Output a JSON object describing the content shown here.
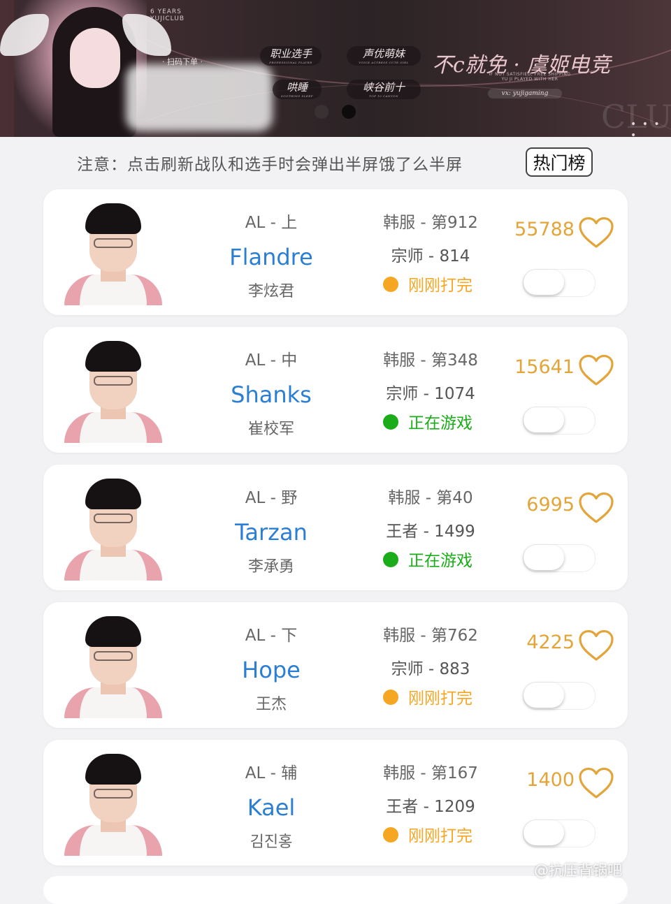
{
  "banner": {
    "years": "6 YEARS",
    "club": "YUJICLUB",
    "scan_text": "· 扫码下单 ·",
    "tags": [
      {
        "label": "职业选手",
        "sub": "PROFESSIONAL PLAYER"
      },
      {
        "label": "声优萌妹",
        "sub": "VOICE ACTRESS CUTE GIRL"
      },
      {
        "label": "峡谷前十",
        "sub": "TOP 10 CANYON"
      },
      {
        "label": "哄睡",
        "sub": "SOOTHING SLEEP"
      }
    ],
    "slogan": "不c就免 · 虞姬电竞",
    "slogan_sub_1": "IF NOT SATISFIED, FREE SHIPPING",
    "slogan_sub_2": "YU JI PLAYED WITH HER",
    "vx": "vx: yujigaming",
    "more": "• • • •",
    "watermark_letters": "CLUB"
  },
  "notice": "注意：点击刷新战队和选手时会弹出半屏饿了么半屏",
  "hot_button": "热门榜",
  "colors": {
    "name_blue": "#2a7fd4",
    "likes_orange": "#e3a53a",
    "status_orange": "#f5a623",
    "status_green": "#1aad19"
  },
  "players": [
    {
      "position": "AL - 上",
      "name": "Flandre",
      "real_name": "李炫君",
      "server": "韩服 - 第912",
      "rank": "宗师 - 814",
      "status": "刚刚打完",
      "status_type": "finished",
      "likes": "55788"
    },
    {
      "position": "AL - 中",
      "name": "Shanks",
      "real_name": "崔校军",
      "server": "韩服 - 第348",
      "rank": "宗师 - 1074",
      "status": "正在游戏",
      "status_type": "playing",
      "likes": "15641"
    },
    {
      "position": "AL - 野",
      "name": "Tarzan",
      "real_name": "李承勇",
      "server": "韩服 - 第40",
      "rank": "王者 - 1499",
      "status": "正在游戏",
      "status_type": "playing",
      "likes": "6995"
    },
    {
      "position": "AL - 下",
      "name": "Hope",
      "real_name": "王杰",
      "server": "韩服 - 第762",
      "rank": "宗师 - 883",
      "status": "刚刚打完",
      "status_type": "finished",
      "likes": "4225"
    },
    {
      "position": "AL - 辅",
      "name": "Kael",
      "real_name": "김진홍",
      "server": "韩服 - 第167",
      "rank": "王者 - 1209",
      "status": "刚刚打完",
      "status_type": "finished",
      "likes": "1400"
    }
  ],
  "footer_watermark": "@抗压背锅吧"
}
